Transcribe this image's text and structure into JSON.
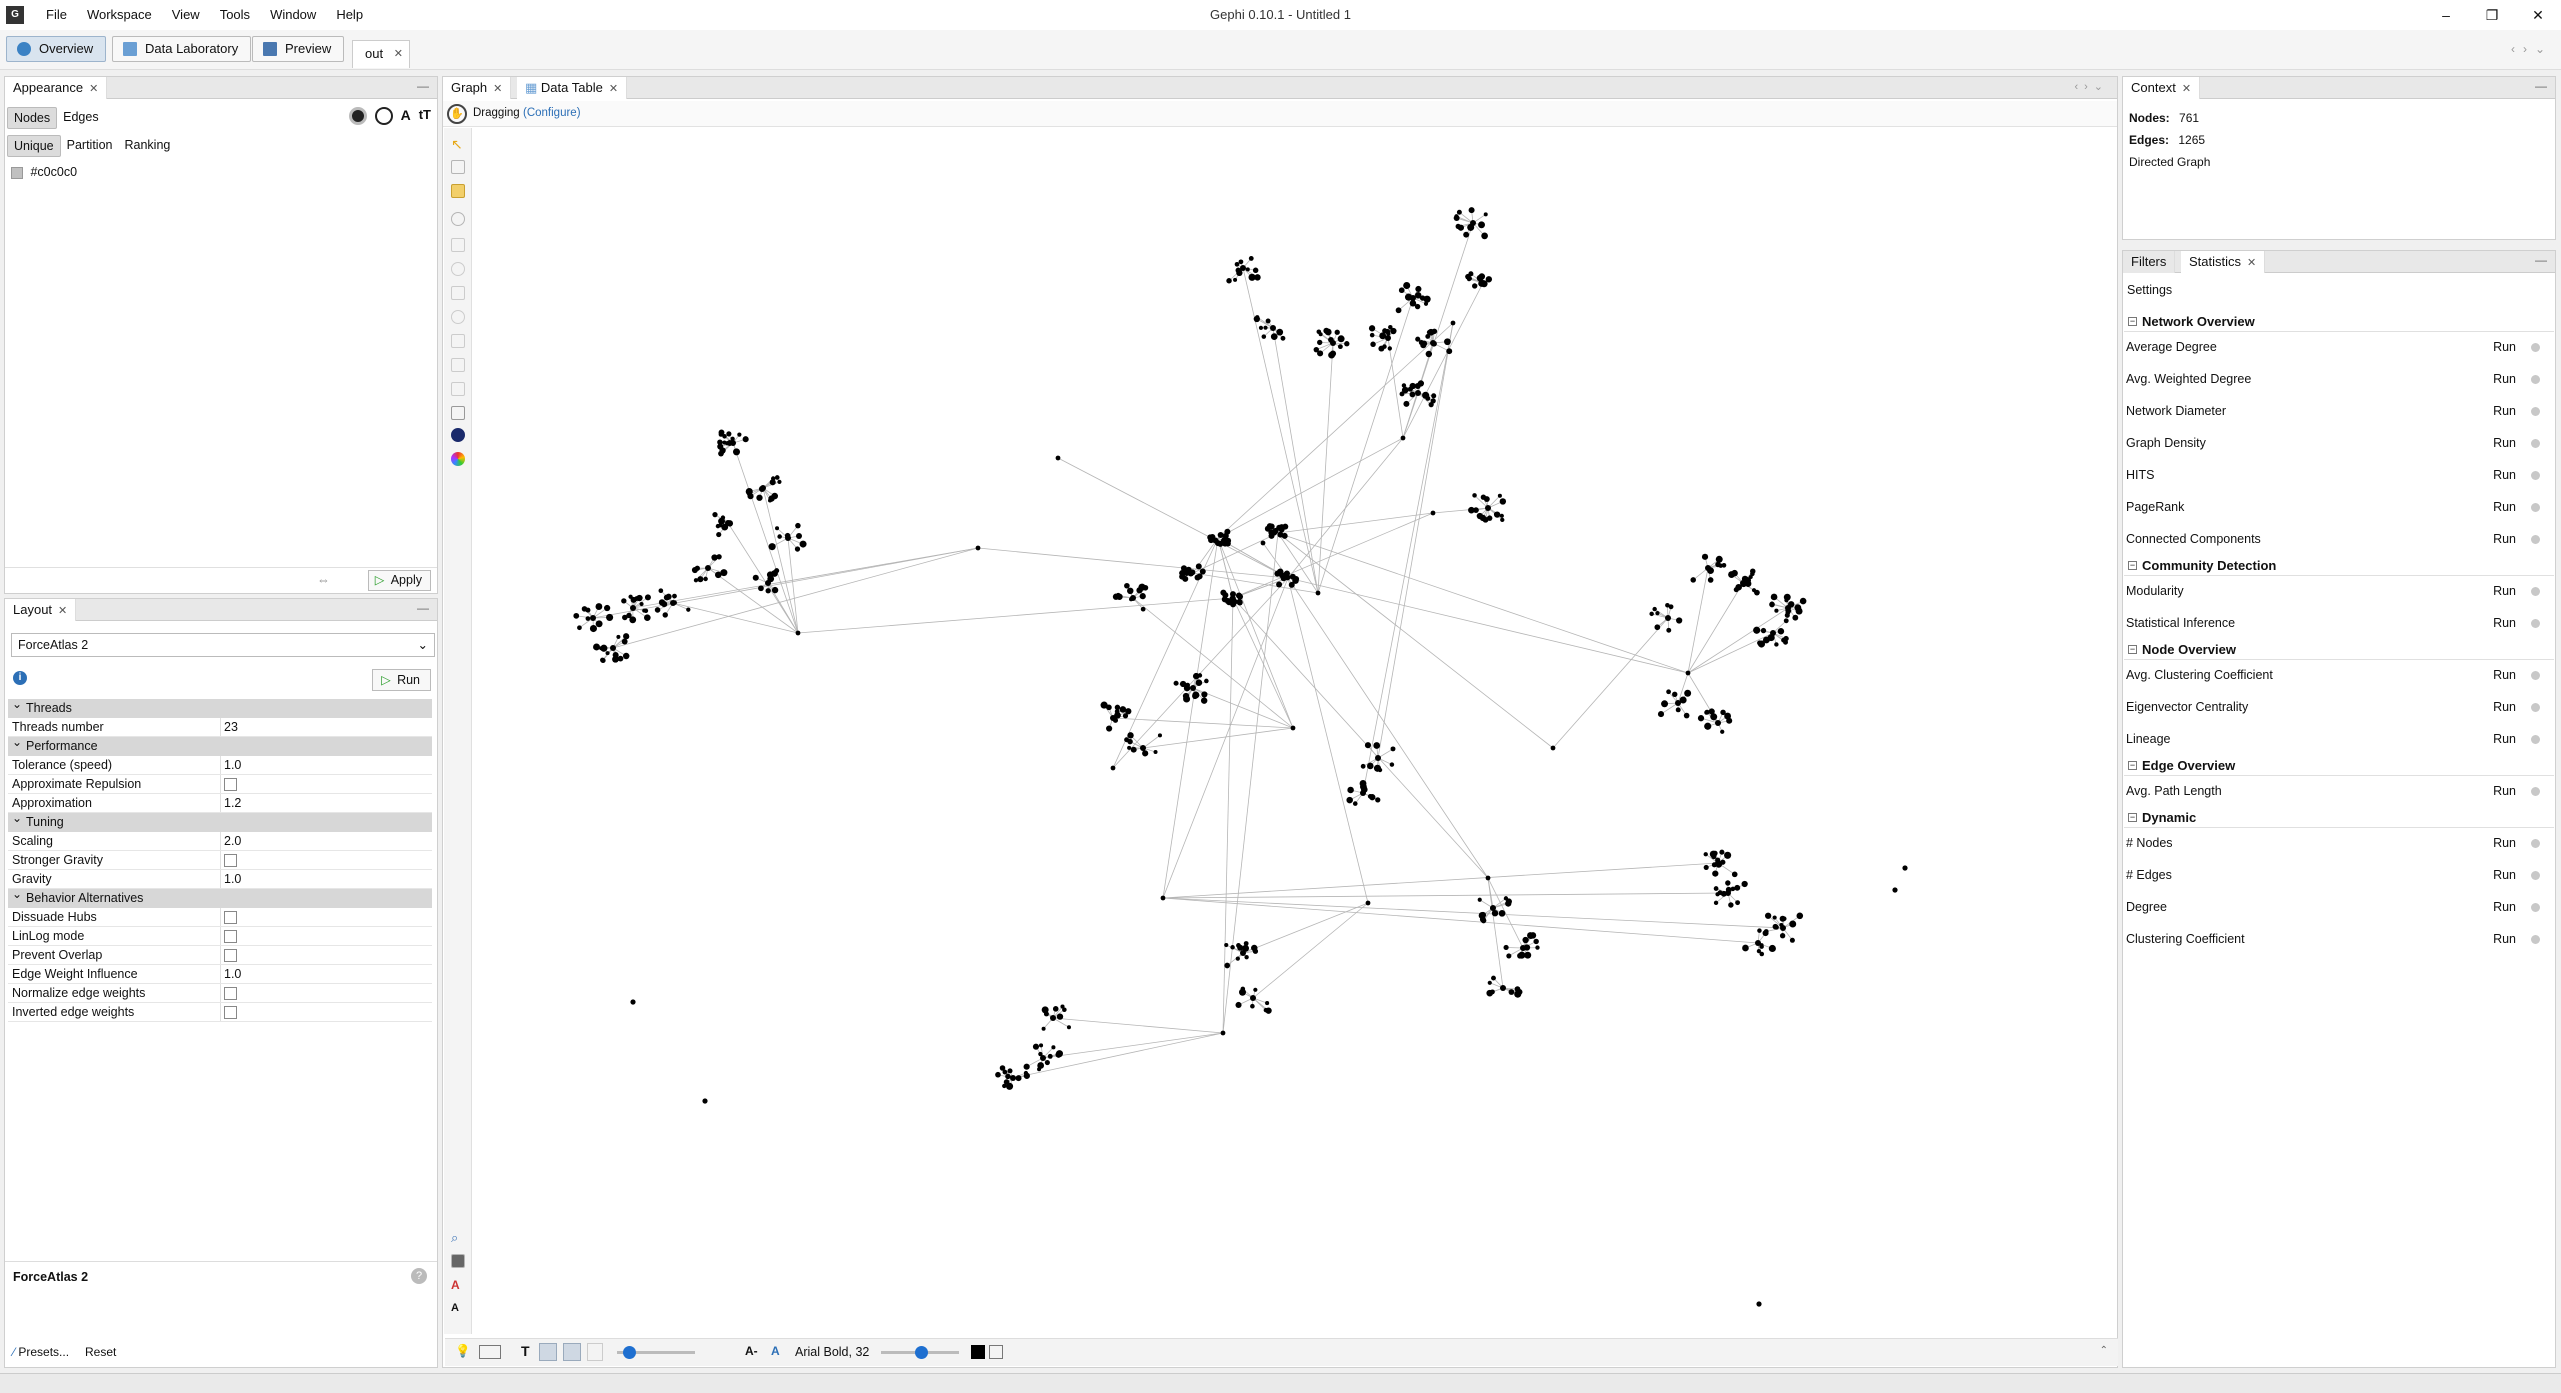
{
  "window": {
    "title": "Gephi 0.10.1 - Untitled 1",
    "menu": [
      "File",
      "Workspace",
      "View",
      "Tools",
      "Window",
      "Help"
    ]
  },
  "modes": {
    "overview": "Overview",
    "data_lab": "Data Laboratory",
    "preview": "Preview",
    "workspace_tab": "out"
  },
  "appearance": {
    "tab": "Appearance",
    "subtabs": [
      "Nodes",
      "Edges"
    ],
    "modes": [
      "Unique",
      "Partition",
      "Ranking"
    ],
    "color_value": "#c0c0c0",
    "apply": "Apply"
  },
  "layout": {
    "tab": "Layout",
    "algorithm": "ForceAtlas 2",
    "run": "Run",
    "categories": {
      "threads": "Threads",
      "performance": "Performance",
      "tuning": "Tuning",
      "behavior": "Behavior Alternatives"
    },
    "props": {
      "threads_number": {
        "k": "Threads number",
        "v": "23"
      },
      "tolerance": {
        "k": "Tolerance (speed)",
        "v": "1.0"
      },
      "approx_repulsion": {
        "k": "Approximate Repulsion"
      },
      "approximation": {
        "k": "Approximation",
        "v": "1.2"
      },
      "scaling": {
        "k": "Scaling",
        "v": "2.0"
      },
      "stronger_gravity": {
        "k": "Stronger Gravity"
      },
      "gravity": {
        "k": "Gravity",
        "v": "1.0"
      },
      "dissuade_hubs": {
        "k": "Dissuade Hubs"
      },
      "linlog": {
        "k": "LinLog mode"
      },
      "prevent_overlap": {
        "k": "Prevent Overlap"
      },
      "edge_weight_influence": {
        "k": "Edge Weight Influence",
        "v": "1.0"
      },
      "normalize_edge_weights": {
        "k": "Normalize edge weights"
      },
      "inverted_edge_weights": {
        "k": "Inverted edge weights"
      }
    },
    "description_title": "ForceAtlas 2",
    "presets": "Presets...",
    "reset": "Reset"
  },
  "graph": {
    "tabs": [
      "Graph",
      "Data Table"
    ],
    "mode": "Dragging",
    "configure": "(Configure)",
    "font_label": "Arial Bold, 32"
  },
  "context": {
    "tab": "Context",
    "nodes_label": "Nodes:",
    "nodes_value": "761",
    "edges_label": "Edges:",
    "edges_value": "1265",
    "graph_type": "Directed Graph"
  },
  "statistics": {
    "tabs": [
      "Filters",
      "Statistics"
    ],
    "settings": "Settings",
    "run_label": "Run",
    "categories": [
      {
        "name": "Network Overview",
        "items": [
          "Average Degree",
          "Avg. Weighted Degree",
          "Network Diameter",
          "Graph Density",
          "HITS",
          "PageRank",
          "Connected Components"
        ]
      },
      {
        "name": "Community Detection",
        "items": [
          "Modularity",
          "Statistical Inference"
        ]
      },
      {
        "name": "Node Overview",
        "items": [
          "Avg. Clustering Coefficient",
          "Eigenvector Centrality",
          "Lineage"
        ]
      },
      {
        "name": "Edge Overview",
        "items": [
          "Avg. Path Length"
        ]
      },
      {
        "name": "Dynamic",
        "items": [
          "# Nodes",
          "# Edges",
          "Degree",
          "Clustering Coefficient"
        ]
      }
    ]
  }
}
